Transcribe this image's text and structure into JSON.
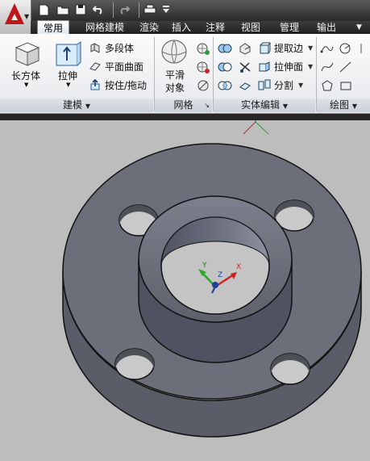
{
  "qat": {
    "icons": [
      "app-menu-icon",
      "new-icon",
      "open-icon",
      "save-icon",
      "undo-icon",
      "redo-icon",
      "plot-icon",
      "customize-icon"
    ]
  },
  "tabs": [
    {
      "label": "常用",
      "active": true
    },
    {
      "label": "网格建模"
    },
    {
      "label": "渲染"
    },
    {
      "label": "插入"
    },
    {
      "label": "注释"
    },
    {
      "label": "视图"
    },
    {
      "label": "管理"
    },
    {
      "label": "输出"
    }
  ],
  "ribbon": {
    "modeling": {
      "title": "建模",
      "box_label": "长方体",
      "extrude_label": "拉伸",
      "polysolid_label": "多段体",
      "planar_label": "平面曲面",
      "presspull_label": "按住/拖动"
    },
    "mesh": {
      "title": "网格",
      "smooth_label_1": "平滑",
      "smooth_label_2": "对象"
    },
    "solid_edit": {
      "title": "实体编辑",
      "extract_label": "提取边",
      "extrude_face_label": "拉伸面",
      "separate_label": "分割"
    },
    "draw": {
      "title": "绘图"
    }
  },
  "ucs": {
    "x_label": "X",
    "y_label": "Y",
    "z_label": "Z"
  },
  "colors": {
    "accent": "#c0171b",
    "model_face": "#666a73",
    "model_edge": "#111111",
    "viewport_bg": "#bdbdbd"
  }
}
